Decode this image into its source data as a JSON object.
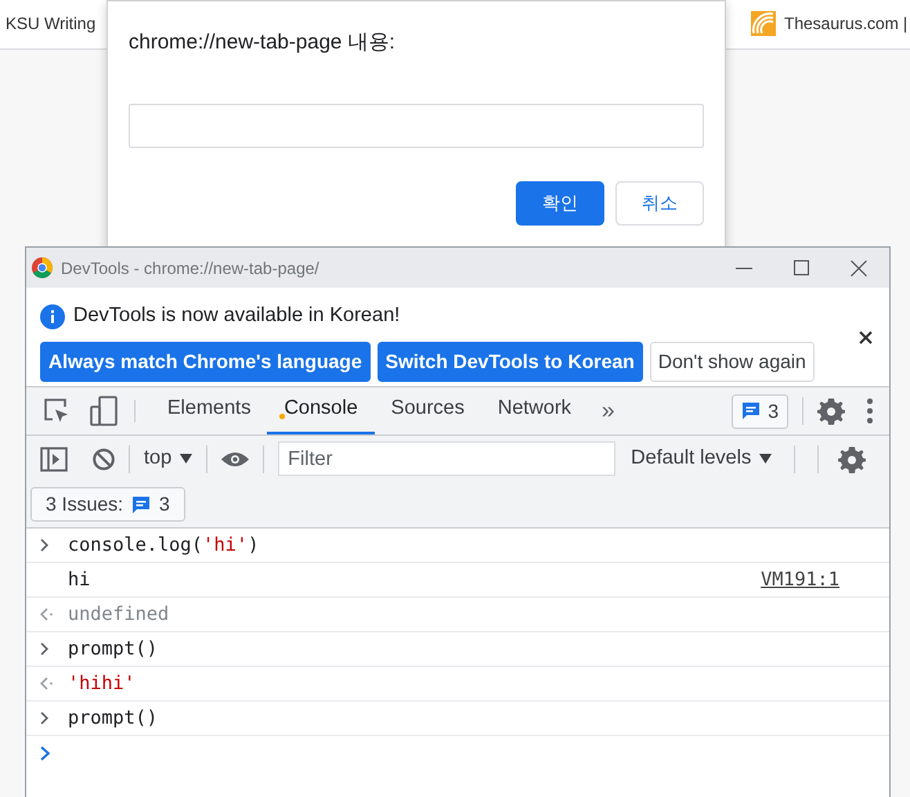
{
  "bookmarks": [
    {
      "label": "KSU Writing",
      "icon": false
    },
    {
      "label": "Thesaurus.com |",
      "icon": true
    }
  ],
  "prompt_dialog": {
    "title": "chrome://new-tab-page 내용:",
    "buttons": [
      {
        "label": "확인",
        "kind": "primary"
      },
      {
        "label": "취소",
        "kind": "secondary"
      }
    ]
  },
  "devtools": {
    "window": {
      "title": "DevTools - chrome://new-tab-page/"
    },
    "infobar": {
      "message": "DevTools is now available in Korean!",
      "buttons": [
        {
          "label": "Always match Chrome's language",
          "kind": "primary"
        },
        {
          "label": "Switch DevTools to Korean",
          "kind": "primary"
        },
        {
          "label": "Don't show again",
          "kind": "secondary"
        }
      ]
    },
    "tabs": [
      {
        "label": "Elements",
        "selected": false,
        "warning": false
      },
      {
        "label": "Console",
        "selected": true,
        "warning": true
      },
      {
        "label": "Sources",
        "selected": false,
        "warning": false
      },
      {
        "label": "Network",
        "selected": false,
        "warning": false
      }
    ],
    "more_tabs": "»",
    "issue_count": "3",
    "console_toolbar": {
      "context": "top",
      "filter_placeholder": "Filter",
      "levels": "Default levels"
    },
    "issues_label": "3 Issues:",
    "issues_count": "3",
    "console_lines": [
      {
        "kind": "input",
        "parts": [
          {
            "text": "console.log(",
            "kind": "code"
          },
          {
            "text": "'hi'",
            "kind": "string"
          },
          {
            "text": ")",
            "kind": "code"
          }
        ]
      },
      {
        "kind": "log",
        "parts": [
          {
            "text": "hi",
            "kind": "code"
          }
        ],
        "source": "VM191:1"
      },
      {
        "kind": "result",
        "parts": [
          {
            "text": "undefined",
            "kind": "muted"
          }
        ]
      },
      {
        "kind": "input",
        "parts": [
          {
            "text": "prompt()",
            "kind": "code"
          }
        ]
      },
      {
        "kind": "result",
        "parts": [
          {
            "text": "'hihi'",
            "kind": "string"
          }
        ]
      },
      {
        "kind": "input",
        "parts": [
          {
            "text": "prompt()",
            "kind": "code"
          }
        ]
      },
      {
        "kind": "prompt"
      }
    ]
  }
}
